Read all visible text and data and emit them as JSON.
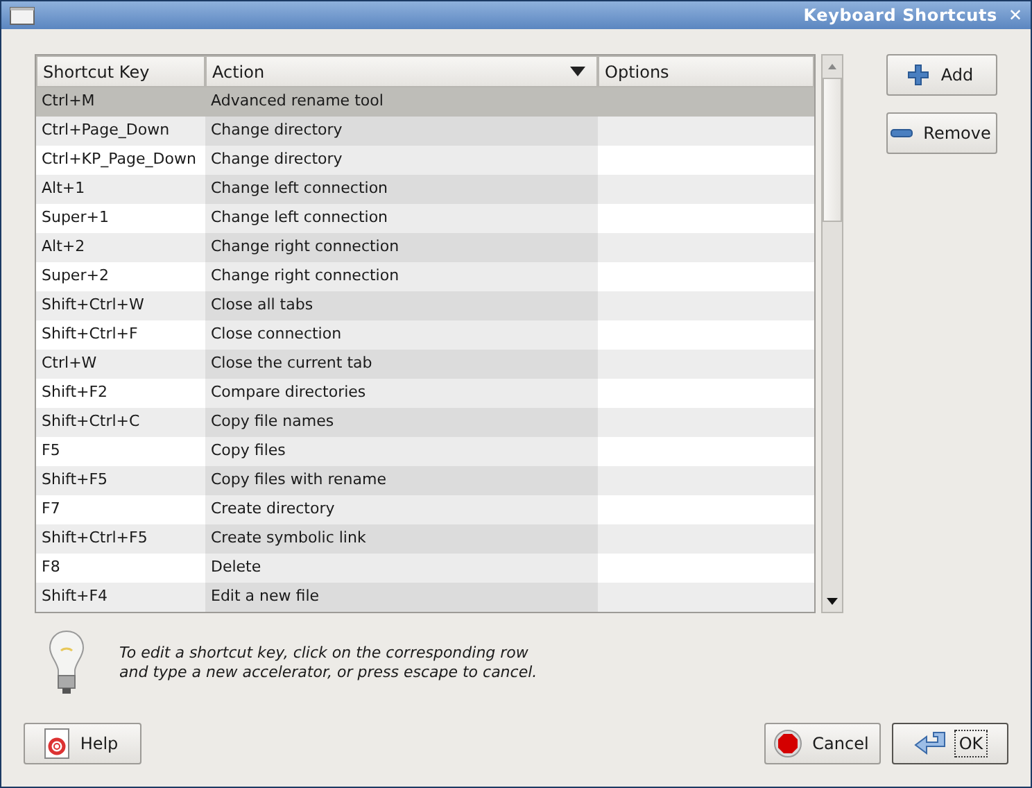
{
  "window": {
    "title": "Keyboard Shortcuts",
    "close": "✕"
  },
  "table": {
    "columns": [
      {
        "label": "Shortcut Key",
        "sorted": false
      },
      {
        "label": "Action",
        "sorted": true
      },
      {
        "label": "Options",
        "sorted": false
      }
    ],
    "rows": [
      {
        "key": "Ctrl+M",
        "action": "Advanced rename tool",
        "selected": true
      },
      {
        "key": "Ctrl+Page_Down",
        "action": "Change directory",
        "selected": false
      },
      {
        "key": "Ctrl+KP_Page_Down",
        "action": "Change directory",
        "selected": false
      },
      {
        "key": "Alt+1",
        "action": "Change left connection",
        "selected": false
      },
      {
        "key": "Super+1",
        "action": "Change left connection",
        "selected": false
      },
      {
        "key": "Alt+2",
        "action": "Change right connection",
        "selected": false
      },
      {
        "key": "Super+2",
        "action": "Change right connection",
        "selected": false
      },
      {
        "key": "Shift+Ctrl+W",
        "action": "Close all tabs",
        "selected": false
      },
      {
        "key": "Shift+Ctrl+F",
        "action": "Close connection",
        "selected": false
      },
      {
        "key": "Ctrl+W",
        "action": "Close the current tab",
        "selected": false
      },
      {
        "key": "Shift+F2",
        "action": "Compare directories",
        "selected": false
      },
      {
        "key": "Shift+Ctrl+C",
        "action": "Copy file names",
        "selected": false
      },
      {
        "key": "F5",
        "action": "Copy files",
        "selected": false
      },
      {
        "key": "Shift+F5",
        "action": "Copy files with rename",
        "selected": false
      },
      {
        "key": "F7",
        "action": "Create directory",
        "selected": false
      },
      {
        "key": "Shift+Ctrl+F5",
        "action": "Create symbolic link",
        "selected": false
      },
      {
        "key": "F8",
        "action": "Delete",
        "selected": false
      },
      {
        "key": "Shift+F4",
        "action": "Edit a new file",
        "selected": false
      }
    ]
  },
  "side_buttons": [
    {
      "label": "Add",
      "kind": "add"
    },
    {
      "label": "Remove",
      "kind": "remove"
    }
  ],
  "hint": [
    "To edit a shortcut key, click on the corresponding row",
    "and type a new accelerator, or press escape to cancel."
  ],
  "buttons": [
    {
      "label": "Help",
      "kind": "help",
      "focused": false
    },
    {
      "label": "Cancel",
      "kind": "cancel",
      "focused": false
    },
    {
      "label": "OK",
      "kind": "ok",
      "focused": true
    }
  ]
}
